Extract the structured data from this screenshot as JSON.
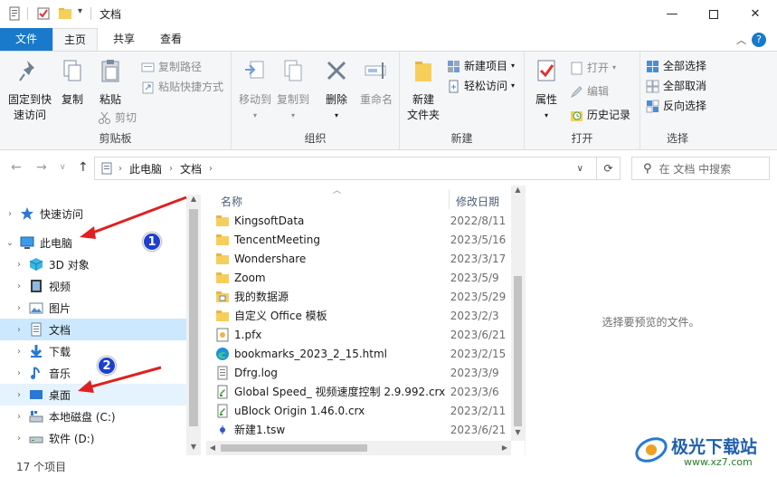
{
  "window": {
    "title": "文档",
    "controls": [
      "minimize-icon",
      "maximize-icon",
      "close-icon"
    ]
  },
  "ribbon_tabs": {
    "file": "文件",
    "home": "主页",
    "share": "共享",
    "view": "查看",
    "help": "?"
  },
  "ribbon": {
    "clipboard": {
      "label": "剪贴板",
      "pin_line1": "固定到快",
      "pin_line2": "速访问",
      "copy": "复制",
      "paste": "粘贴",
      "copy_path": "复制路径",
      "paste_shortcut": "粘贴快捷方式",
      "cut": "剪切"
    },
    "organize": {
      "label": "组织",
      "move_to": "移动到",
      "copy_to": "复制到",
      "delete": "删除",
      "rename": "重命名"
    },
    "new": {
      "label": "新建",
      "new_folder_line1": "新建",
      "new_folder_line2": "文件夹",
      "new_item": "新建项目",
      "easy_access": "轻松访问"
    },
    "open": {
      "label": "打开",
      "properties": "属性",
      "open": "打开",
      "edit": "编辑",
      "history": "历史记录"
    },
    "select": {
      "label": "选择",
      "select_all": "全部选择",
      "select_none": "全部取消",
      "invert": "反向选择"
    }
  },
  "address": {
    "crumbs": [
      "此电脑",
      "文档"
    ],
    "search_placeholder": "在 文档 中搜索"
  },
  "nav": {
    "items": [
      {
        "label": "快速访问",
        "icon": "star-icon"
      },
      {
        "label": "此电脑",
        "icon": "computer-icon"
      },
      {
        "label": "3D 对象",
        "icon": "cube-icon"
      },
      {
        "label": "视频",
        "icon": "video-icon"
      },
      {
        "label": "图片",
        "icon": "picture-icon"
      },
      {
        "label": "文档",
        "icon": "document-icon"
      },
      {
        "label": "下载",
        "icon": "download-icon"
      },
      {
        "label": "音乐",
        "icon": "music-icon"
      },
      {
        "label": "桌面",
        "icon": "desktop-icon"
      },
      {
        "label": "本地磁盘 (C:)",
        "icon": "drive-icon"
      },
      {
        "label": "软件 (D:)",
        "icon": "drive-icon"
      }
    ]
  },
  "files": {
    "col_name": "名称",
    "col_date": "修改日期",
    "rows": [
      {
        "name": "KingsoftData",
        "date": "2022/8/11",
        "icon": "folder-icon"
      },
      {
        "name": "TencentMeeting",
        "date": "2023/5/16",
        "icon": "folder-icon"
      },
      {
        "name": "Wondershare",
        "date": "2023/3/17",
        "icon": "folder-icon"
      },
      {
        "name": "Zoom",
        "date": "2023/5/9",
        "icon": "folder-icon"
      },
      {
        "name": "我的数据源",
        "date": "2023/5/29",
        "icon": "data-source-icon"
      },
      {
        "name": "自定义 Office 模板",
        "date": "2023/2/3",
        "icon": "folder-icon"
      },
      {
        "name": "1.pfx",
        "date": "2023/6/21",
        "icon": "certificate-icon"
      },
      {
        "name": "bookmarks_2023_2_15.html",
        "date": "2023/2/15",
        "icon": "edge-icon"
      },
      {
        "name": "Dfrg.log",
        "date": "2023/3/9",
        "icon": "text-file-icon"
      },
      {
        "name": "Global Speed_ 视频速度控制 2.9.992.crx",
        "date": "2023/3/6",
        "icon": "crx-icon"
      },
      {
        "name": "uBlock Origin 1.46.0.crx",
        "date": "2023/2/11",
        "icon": "crx-icon"
      },
      {
        "name": "新建1.tsw",
        "date": "2023/6/21",
        "icon": "tsw-icon"
      }
    ]
  },
  "preview": {
    "message": "选择要预览的文件。"
  },
  "status": {
    "count": "17 个项目"
  },
  "annotations": {
    "badge1": "1",
    "badge2": "2"
  },
  "watermark": {
    "text": "极光下载站",
    "url": "www.xz7.com"
  },
  "colors": {
    "accent": "#1979ca",
    "selection": "#cce8ff",
    "arrow": "#e02020",
    "badge": "#1c3fd1"
  }
}
